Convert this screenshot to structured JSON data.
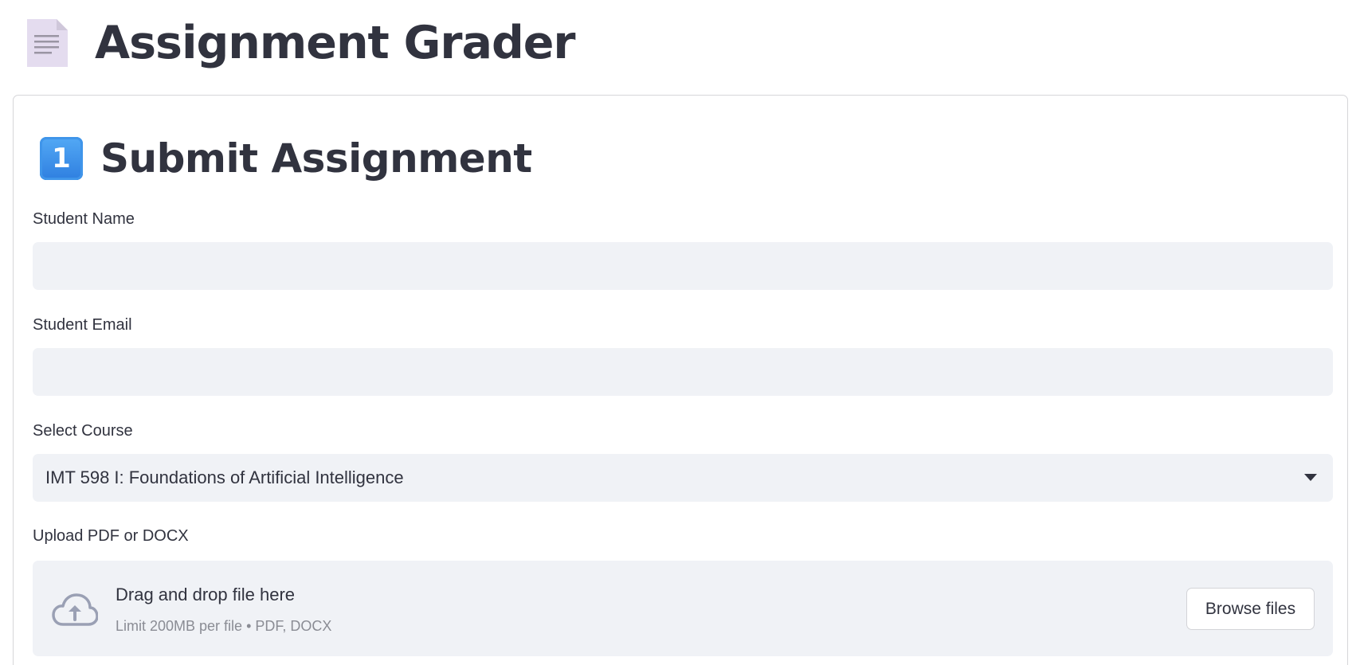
{
  "app": {
    "title": "Assignment Grader"
  },
  "section": {
    "number": "1",
    "title": "Submit Assignment"
  },
  "fields": {
    "student_name": {
      "label": "Student Name",
      "value": ""
    },
    "student_email": {
      "label": "Student Email",
      "value": ""
    },
    "course": {
      "label": "Select Course",
      "selected": "IMT 598 I: Foundations of Artificial Intelligence"
    },
    "upload": {
      "label": "Upload PDF or DOCX",
      "drop_text": "Drag and drop file here",
      "limit_text": "Limit 200MB per file • PDF, DOCX",
      "browse_label": "Browse files"
    }
  },
  "icons": {
    "title_icon": "document-icon",
    "section_icon": "keycap-one-icon",
    "select_icon": "caret-down-icon",
    "upload_icon": "cloud-upload-icon"
  },
  "colors": {
    "text": "#31333f",
    "input_bg": "#f0f2f6",
    "keycap_blue": "#3f95ea",
    "muted": "#8a8c94"
  }
}
